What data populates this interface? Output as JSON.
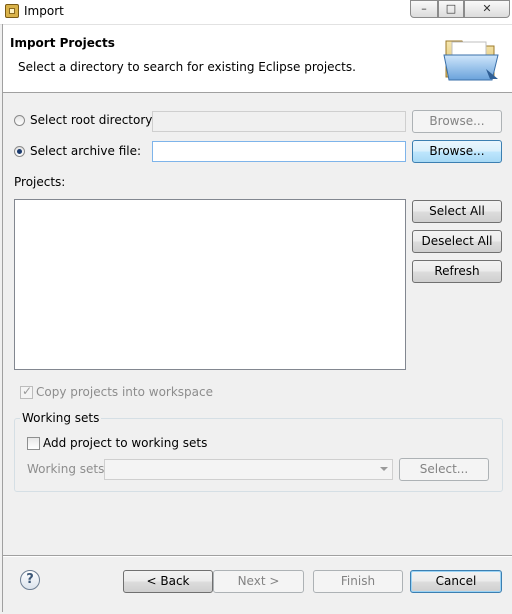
{
  "window": {
    "title": "Import",
    "minimize_glyph": "–",
    "maximize_glyph": "□",
    "close_glyph": "✕"
  },
  "header": {
    "title": "Import Projects",
    "description": "Select a directory to search for existing Eclipse projects.",
    "icon": "folder-import-icon"
  },
  "source": {
    "root_directory_label": "Select root directory:",
    "root_directory_value": "",
    "root_browse_label": "Browse...",
    "archive_file_label": "Select archive file:",
    "archive_file_value": "",
    "archive_browse_label": "Browse...",
    "selected": "archive"
  },
  "projects": {
    "label": "Projects:",
    "items": [],
    "select_all_label": "Select All",
    "deselect_all_label": "Deselect All",
    "refresh_label": "Refresh"
  },
  "copy_projects": {
    "label": "Copy projects into workspace",
    "checked": true,
    "enabled": false
  },
  "working_sets": {
    "group_title": "Working sets",
    "add_label": "Add project to working sets",
    "add_checked": false,
    "sets_label": "Working sets:",
    "sets_value": "",
    "select_label": "Select..."
  },
  "footer": {
    "help_glyph": "?",
    "back_label": "< Back",
    "next_label": "Next >",
    "finish_label": "Finish",
    "cancel_label": "Cancel"
  },
  "colors": {
    "accent_border": "#3c7fb1",
    "dialog_bg": "#f0f0f0",
    "disabled_text": "#838383"
  }
}
